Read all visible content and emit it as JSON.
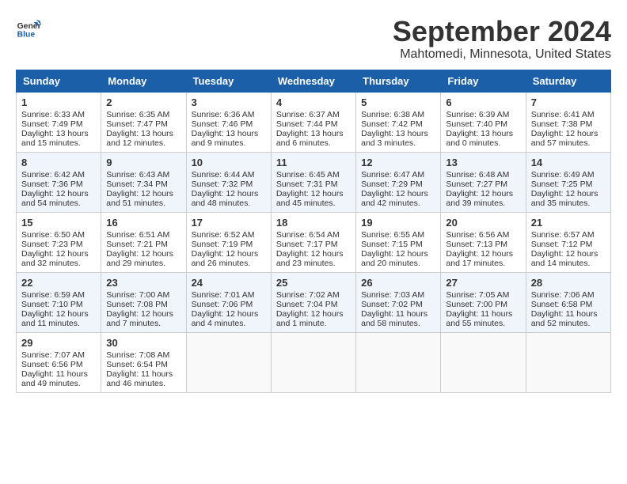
{
  "header": {
    "logo_line1": "General",
    "logo_line2": "Blue",
    "month_title": "September 2024",
    "location": "Mahtomedi, Minnesota, United States"
  },
  "days_of_week": [
    "Sunday",
    "Monday",
    "Tuesday",
    "Wednesday",
    "Thursday",
    "Friday",
    "Saturday"
  ],
  "weeks": [
    [
      {
        "day": "1",
        "sunrise": "6:33 AM",
        "sunset": "7:49 PM",
        "daylight": "13 hours and 15 minutes."
      },
      {
        "day": "2",
        "sunrise": "6:35 AM",
        "sunset": "7:47 PM",
        "daylight": "13 hours and 12 minutes."
      },
      {
        "day": "3",
        "sunrise": "6:36 AM",
        "sunset": "7:46 PM",
        "daylight": "13 hours and 9 minutes."
      },
      {
        "day": "4",
        "sunrise": "6:37 AM",
        "sunset": "7:44 PM",
        "daylight": "13 hours and 6 minutes."
      },
      {
        "day": "5",
        "sunrise": "6:38 AM",
        "sunset": "7:42 PM",
        "daylight": "13 hours and 3 minutes."
      },
      {
        "day": "6",
        "sunrise": "6:39 AM",
        "sunset": "7:40 PM",
        "daylight": "13 hours and 0 minutes."
      },
      {
        "day": "7",
        "sunrise": "6:41 AM",
        "sunset": "7:38 PM",
        "daylight": "12 hours and 57 minutes."
      }
    ],
    [
      {
        "day": "8",
        "sunrise": "6:42 AM",
        "sunset": "7:36 PM",
        "daylight": "12 hours and 54 minutes."
      },
      {
        "day": "9",
        "sunrise": "6:43 AM",
        "sunset": "7:34 PM",
        "daylight": "12 hours and 51 minutes."
      },
      {
        "day": "10",
        "sunrise": "6:44 AM",
        "sunset": "7:32 PM",
        "daylight": "12 hours and 48 minutes."
      },
      {
        "day": "11",
        "sunrise": "6:45 AM",
        "sunset": "7:31 PM",
        "daylight": "12 hours and 45 minutes."
      },
      {
        "day": "12",
        "sunrise": "6:47 AM",
        "sunset": "7:29 PM",
        "daylight": "12 hours and 42 minutes."
      },
      {
        "day": "13",
        "sunrise": "6:48 AM",
        "sunset": "7:27 PM",
        "daylight": "12 hours and 39 minutes."
      },
      {
        "day": "14",
        "sunrise": "6:49 AM",
        "sunset": "7:25 PM",
        "daylight": "12 hours and 35 minutes."
      }
    ],
    [
      {
        "day": "15",
        "sunrise": "6:50 AM",
        "sunset": "7:23 PM",
        "daylight": "12 hours and 32 minutes."
      },
      {
        "day": "16",
        "sunrise": "6:51 AM",
        "sunset": "7:21 PM",
        "daylight": "12 hours and 29 minutes."
      },
      {
        "day": "17",
        "sunrise": "6:52 AM",
        "sunset": "7:19 PM",
        "daylight": "12 hours and 26 minutes."
      },
      {
        "day": "18",
        "sunrise": "6:54 AM",
        "sunset": "7:17 PM",
        "daylight": "12 hours and 23 minutes."
      },
      {
        "day": "19",
        "sunrise": "6:55 AM",
        "sunset": "7:15 PM",
        "daylight": "12 hours and 20 minutes."
      },
      {
        "day": "20",
        "sunrise": "6:56 AM",
        "sunset": "7:13 PM",
        "daylight": "12 hours and 17 minutes."
      },
      {
        "day": "21",
        "sunrise": "6:57 AM",
        "sunset": "7:12 PM",
        "daylight": "12 hours and 14 minutes."
      }
    ],
    [
      {
        "day": "22",
        "sunrise": "6:59 AM",
        "sunset": "7:10 PM",
        "daylight": "12 hours and 11 minutes."
      },
      {
        "day": "23",
        "sunrise": "7:00 AM",
        "sunset": "7:08 PM",
        "daylight": "12 hours and 7 minutes."
      },
      {
        "day": "24",
        "sunrise": "7:01 AM",
        "sunset": "7:06 PM",
        "daylight": "12 hours and 4 minutes."
      },
      {
        "day": "25",
        "sunrise": "7:02 AM",
        "sunset": "7:04 PM",
        "daylight": "12 hours and 1 minute."
      },
      {
        "day": "26",
        "sunrise": "7:03 AM",
        "sunset": "7:02 PM",
        "daylight": "11 hours and 58 minutes."
      },
      {
        "day": "27",
        "sunrise": "7:05 AM",
        "sunset": "7:00 PM",
        "daylight": "11 hours and 55 minutes."
      },
      {
        "day": "28",
        "sunrise": "7:06 AM",
        "sunset": "6:58 PM",
        "daylight": "11 hours and 52 minutes."
      }
    ],
    [
      {
        "day": "29",
        "sunrise": "7:07 AM",
        "sunset": "6:56 PM",
        "daylight": "11 hours and 49 minutes."
      },
      {
        "day": "30",
        "sunrise": "7:08 AM",
        "sunset": "6:54 PM",
        "daylight": "11 hours and 46 minutes."
      },
      null,
      null,
      null,
      null,
      null
    ]
  ]
}
